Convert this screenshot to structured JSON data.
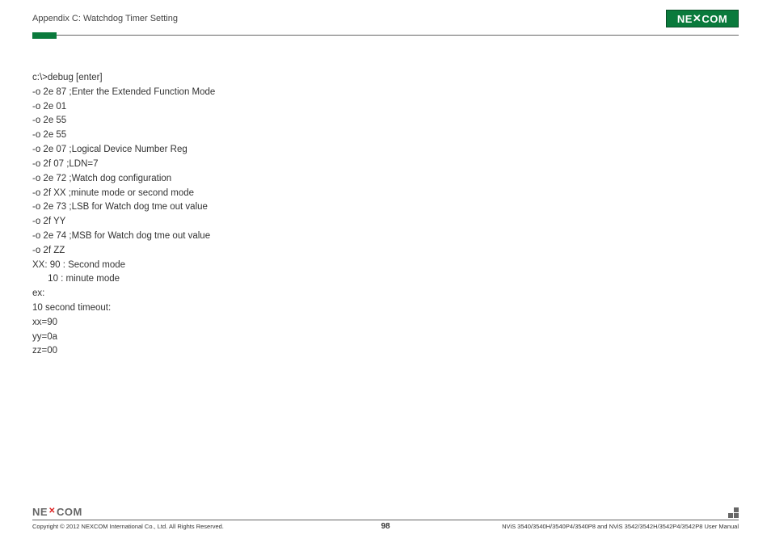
{
  "header": {
    "title": "Appendix C: Watchdog Timer Setting",
    "logo_text_left": "NE",
    "logo_text_right": "COM"
  },
  "content": {
    "lines": [
      "c:\\>debug [enter]",
      "-o 2e 87 ;Enter the Extended Function Mode",
      "-o 2e 01",
      "-o 2e 55",
      "-o 2e 55",
      "-o 2e 07 ;Logical Device Number Reg",
      "-o 2f 07 ;LDN=7",
      "-o 2e 72 ;Watch dog configuration",
      "-o 2f XX ;minute mode or second mode",
      "-o 2e 73 ;LSB for Watch dog tme out value",
      "-o 2f YY",
      "-o 2e 74 ;MSB for Watch dog tme out value",
      "-o 2f ZZ",
      "",
      "XX: 90 : Second mode",
      "      10 : minute mode",
      "ex:",
      "10 second timeout:",
      "xx=90",
      "yy=0a",
      "zz=00"
    ]
  },
  "footer": {
    "logo_text_left": "NE",
    "logo_text_right": "COM",
    "copyright": "Copyright © 2012 NEXCOM International Co., Ltd. All Rights Reserved.",
    "page_number": "98",
    "manual_ref": "NViS 3540/3540H/3540P4/3540P8 and NViS 3542/3542H/3542P4/3542P8 User Manual"
  }
}
